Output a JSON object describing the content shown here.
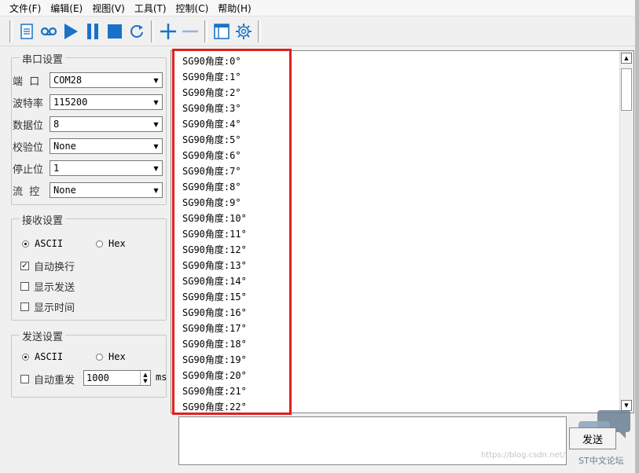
{
  "menu": [
    "文件(F)",
    "编辑(E)",
    "视图(V)",
    "工具(T)",
    "控制(C)",
    "帮助(H)"
  ],
  "toolbar": {
    "icons": [
      "document-icon",
      "record-icon",
      "play-icon",
      "pause-icon",
      "stop-icon",
      "refresh-icon",
      "plus-icon",
      "minus-icon",
      "window-icon",
      "gear-icon"
    ]
  },
  "serial": {
    "title": "串口设置",
    "port_label": "端  口",
    "port_value": "COM28",
    "baud_label": "波特率",
    "baud_value": "115200",
    "databits_label": "数据位",
    "databits_value": "8",
    "parity_label": "校验位",
    "parity_value": "None",
    "stopbits_label": "停止位",
    "stopbits_value": "1",
    "flow_label": "流  控",
    "flow_value": "None"
  },
  "receive": {
    "title": "接收设置",
    "ascii": "ASCII",
    "hex": "Hex",
    "autowrap": "自动换行",
    "show_send": "显示发送",
    "show_time": "显示时间"
  },
  "send": {
    "title": "发送设置",
    "ascii": "ASCII",
    "hex": "Hex",
    "auto_resend": "自动重发",
    "interval": "1000",
    "unit": "ms",
    "button": "发送"
  },
  "recv_lines": [
    "SG90角度:0°",
    "SG90角度:1°",
    "SG90角度:2°",
    "SG90角度:3°",
    "SG90角度:4°",
    "SG90角度:5°",
    "SG90角度:6°",
    "SG90角度:7°",
    "SG90角度:8°",
    "SG90角度:9°",
    "SG90角度:10°",
    "SG90角度:11°",
    "SG90角度:12°",
    "SG90角度:13°",
    "SG90角度:14°",
    "SG90角度:15°",
    "SG90角度:16°",
    "SG90角度:17°",
    "SG90角度:18°",
    "SG90角度:19°",
    "SG90角度:20°",
    "SG90角度:21°",
    "SG90角度:22°"
  ],
  "watermark": "https://blog.csdn.net/",
  "brand": "ST中文论坛",
  "colors": {
    "accent": "#1a72c8",
    "highlight": "#e02020"
  }
}
